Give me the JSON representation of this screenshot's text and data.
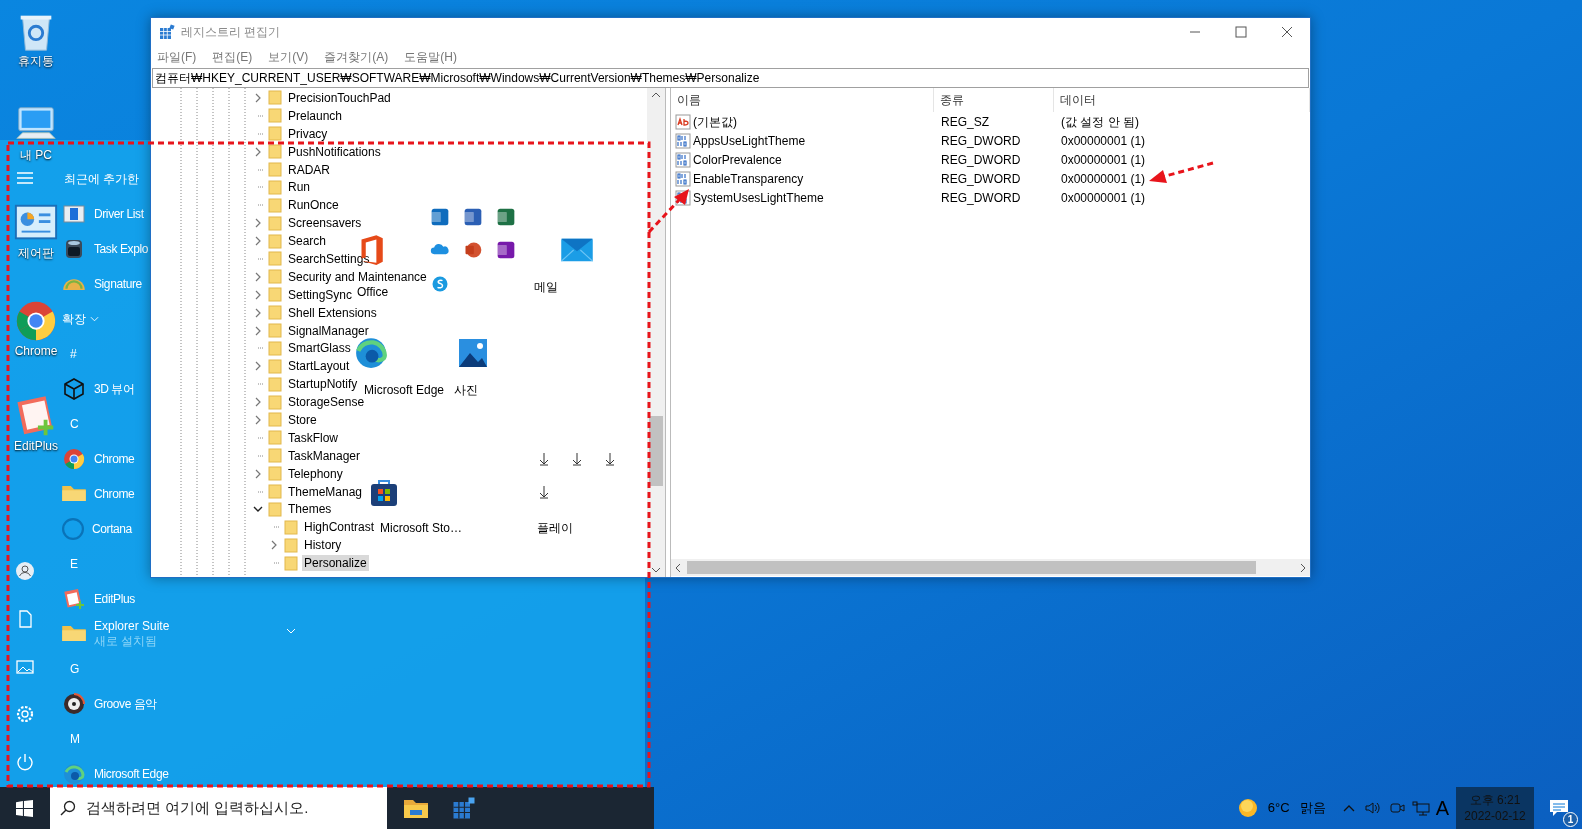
{
  "desktop_icons": [
    {
      "label": "휴지통"
    },
    {
      "label": "내 PC"
    },
    {
      "label": "제어판"
    },
    {
      "label": "Chrome"
    },
    {
      "label": "EditPlus"
    }
  ],
  "start_menu": {
    "app_list": [
      {
        "kind": "section",
        "label": "최근에 추가한"
      },
      {
        "kind": "app",
        "label": "Driver List"
      },
      {
        "kind": "app",
        "label": "Task Explo"
      },
      {
        "kind": "app",
        "label": "Signature"
      },
      {
        "kind": "group",
        "label": "확장"
      },
      {
        "kind": "letter",
        "label": "#"
      },
      {
        "kind": "app",
        "label": "3D 뷰어"
      },
      {
        "kind": "letter",
        "label": "C"
      },
      {
        "kind": "app",
        "label": "Chrome"
      },
      {
        "kind": "folder",
        "label": "Chrome"
      },
      {
        "kind": "app",
        "label": "Cortana"
      },
      {
        "kind": "letter",
        "label": "E"
      },
      {
        "kind": "app",
        "label": "EditPlus"
      },
      {
        "kind": "folder",
        "label": "Explorer Suite",
        "note": "새로 설치됨"
      },
      {
        "kind": "letter",
        "label": "G"
      },
      {
        "kind": "app",
        "label": "Groove 음악"
      },
      {
        "kind": "letter",
        "label": "M"
      },
      {
        "kind": "app",
        "label": "Microsoft Edge"
      }
    ],
    "tiles": [
      {
        "label": "Office"
      },
      {
        "label": "메일"
      },
      {
        "label": "Microsoft Edge"
      },
      {
        "label": "사진"
      },
      {
        "label": "Microsoft Sto…"
      },
      {
        "label": "플레이"
      }
    ]
  },
  "window": {
    "title": "레지스트리 편집기",
    "menu": [
      "파일(F)",
      "편집(E)",
      "보기(V)",
      "즐겨찾기(A)",
      "도움말(H)"
    ],
    "address": "컴퓨터₩HKEY_CURRENT_USER₩SOFTWARE₩Microsoft₩Windows₩CurrentVersion₩Themes₩Personalize",
    "tree": [
      {
        "label": "PrecisionTouchPad",
        "expanded": false,
        "selected": false
      },
      {
        "label": "Prelaunch",
        "selected": false
      },
      {
        "label": "Privacy",
        "selected": false
      },
      {
        "label": "PushNotifications",
        "expanded": false,
        "selected": false
      },
      {
        "label": "RADAR",
        "selected": false
      },
      {
        "label": "Run",
        "selected": false
      },
      {
        "label": "RunOnce",
        "selected": false
      },
      {
        "label": "Screensavers",
        "expanded": false,
        "selected": false
      },
      {
        "label": "Search",
        "expanded": false,
        "selected": false
      },
      {
        "label": "SearchSettings",
        "selected": false
      },
      {
        "label": "Security and Maintenance",
        "expanded": false,
        "selected": false
      },
      {
        "label": "SettingSync",
        "expanded": false,
        "selected": false
      },
      {
        "label": "Shell Extensions",
        "expanded": false,
        "selected": false
      },
      {
        "label": "SignalManager",
        "expanded": false,
        "selected": false
      },
      {
        "label": "SmartGlass",
        "selected": false
      },
      {
        "label": "StartLayout",
        "expanded": false,
        "selected": false
      },
      {
        "label": "StartupNotify",
        "selected": false
      },
      {
        "label": "StorageSense",
        "expanded": false,
        "selected": false
      },
      {
        "label": "Store",
        "expanded": false,
        "selected": false
      },
      {
        "label": "TaskFlow",
        "selected": false
      },
      {
        "label": "TaskManager",
        "selected": false
      },
      {
        "label": "Telephony",
        "expanded": false,
        "selected": false
      },
      {
        "label": "ThemeManag",
        "selected": false
      },
      {
        "label": "Themes",
        "expanded": true,
        "selected": false,
        "children": [
          {
            "label": "HighContrast",
            "selected": false
          },
          {
            "label": "History",
            "expanded": false,
            "selected": false
          },
          {
            "label": "Personalize",
            "selected": true
          }
        ]
      }
    ],
    "columns": [
      "이름",
      "종류",
      "데이터"
    ],
    "values": [
      {
        "kind": "string",
        "name": "(기본값)",
        "type": "REG_SZ",
        "data": "(값 설정 안 됨)"
      },
      {
        "kind": "dword",
        "name": "AppsUseLightTheme",
        "type": "REG_DWORD",
        "data": "0x00000001 (1)"
      },
      {
        "kind": "dword",
        "name": "ColorPrevalence",
        "type": "REG_DWORD",
        "data": "0x00000001 (1)"
      },
      {
        "kind": "dword",
        "name": "EnableTransparency",
        "type": "REG_DWORD",
        "data": "0x00000001 (1)"
      },
      {
        "kind": "dword",
        "name": "SystemUsesLightTheme",
        "type": "REG_DWORD",
        "data": "0x00000001 (1)"
      }
    ]
  },
  "taskbar": {
    "search": {
      "placeholder": "검색하려면 여기에 입력하십시오."
    },
    "temperature": "6°C",
    "weather": "맑음",
    "input_mode": "A",
    "time": "오후 6:21",
    "date": "2022-02-12",
    "notification_count": "1"
  }
}
